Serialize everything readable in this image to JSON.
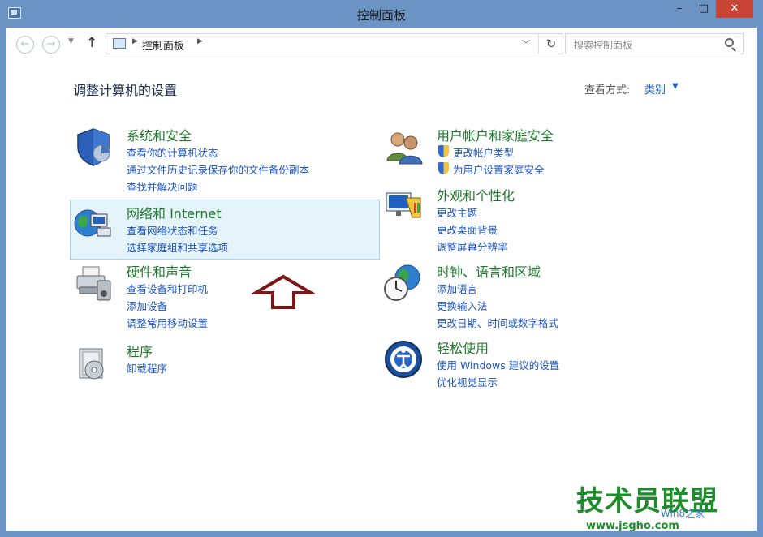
{
  "window": {
    "title": "控制面板",
    "controls": [
      "–",
      "□",
      "✕"
    ]
  },
  "navbar": {
    "back_icon": "←",
    "forward_icon": "→",
    "up_icon": "↑",
    "address": "控制面板",
    "search_placeholder": "搜索控制面板"
  },
  "header": {
    "title": "调整计算机的设置",
    "view_label": "查看方式:",
    "view_value": "类别"
  },
  "categories": [
    {
      "name": "system-security",
      "title": "系统和安全",
      "links": [
        "查看你的计算机状态",
        "通过文件历史记录保存你的文件备份副本",
        "查找并解决问题"
      ]
    },
    {
      "name": "network-internet",
      "title": "网络和 Internet",
      "links": [
        "查看网络状态和任务",
        "选择家庭组和共享选项"
      ]
    },
    {
      "name": "hardware-sound",
      "title": "硬件和声音",
      "links": [
        "查看设备和打印机",
        "添加设备",
        "调整常用移动设置"
      ]
    },
    {
      "name": "programs",
      "title": "程序",
      "links": [
        "卸载程序"
      ]
    },
    {
      "name": "user-accounts",
      "title": "用户帐户和家庭安全",
      "links": [
        "更改帐户类型",
        "为用户设置家庭安全"
      ]
    },
    {
      "name": "appearance",
      "title": "外观和个性化",
      "links": [
        "更改主题",
        "更改桌面背景",
        "调整屏幕分辨率"
      ]
    },
    {
      "name": "clock-language-region",
      "title": "时钟、语言和区域",
      "links": [
        "添加语言",
        "更换输入法",
        "更改日期、时间或数字格式"
      ]
    },
    {
      "name": "ease-of-access",
      "title": "轻松使用",
      "links": [
        "使用 Windows 建议的设置",
        "优化视觉显示"
      ]
    }
  ],
  "watermark": {
    "brand": "技术员联盟",
    "url": "www.jsgho.com",
    "small": "Win8之家"
  },
  "colors": {
    "accent": "#1d56c4",
    "category_title": "#1f7a2c",
    "titlebar": "#6b93c4",
    "arrow": "#7b1717"
  }
}
